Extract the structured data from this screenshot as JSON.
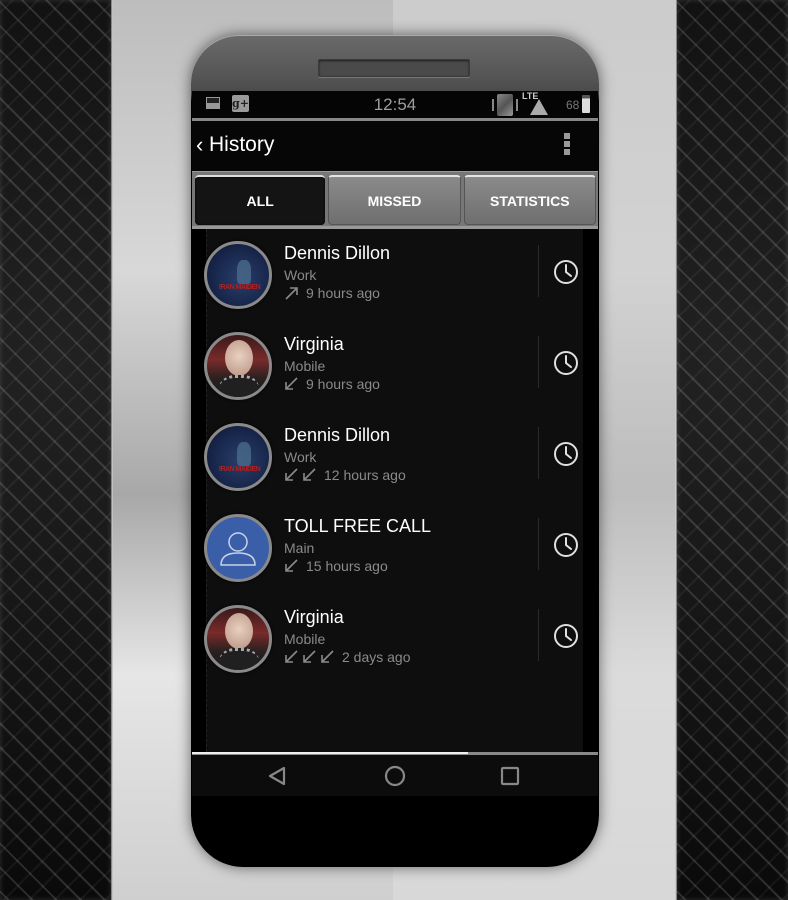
{
  "status_bar": {
    "time": "12:54",
    "network": "LTE",
    "battery": "68",
    "battery_level_percent": 68,
    "icons": [
      "image-icon",
      "google-plus-icon",
      "vibrate-icon",
      "lte-signal-icon",
      "battery-icon"
    ],
    "gplus_glyph": "g+"
  },
  "action_bar": {
    "back_glyph": "‹",
    "title": "History"
  },
  "tabs": [
    {
      "label": "ALL",
      "active": true
    },
    {
      "label": "MISSED",
      "active": false
    },
    {
      "label": "STATISTICS",
      "active": false
    }
  ],
  "calls": [
    {
      "name": "Dennis Dillon",
      "type": "Work",
      "directions": [
        "outgoing"
      ],
      "time": "9 hours ago",
      "avatar": "band-artwork"
    },
    {
      "name": "Virginia",
      "type": "Mobile",
      "directions": [
        "incoming"
      ],
      "time": "9 hours ago",
      "avatar": "photo"
    },
    {
      "name": "Dennis Dillon",
      "type": "Work",
      "directions": [
        "incoming",
        "incoming"
      ],
      "time": "12 hours ago",
      "avatar": "band-artwork"
    },
    {
      "name": "TOLL FREE CALL",
      "type": "Main",
      "directions": [
        "incoming"
      ],
      "time": "15 hours ago",
      "avatar": "generic-contact"
    },
    {
      "name": "Virginia",
      "type": "Mobile",
      "directions": [
        "incoming",
        "incoming",
        "incoming"
      ],
      "time": "2 days ago",
      "avatar": "photo"
    }
  ],
  "scroll_progress": 0.68,
  "nav_bar": [
    "back",
    "home",
    "recents"
  ],
  "colors": {
    "accent_generic_avatar": "#3a5fa8",
    "text_primary": "#ffffff",
    "text_secondary": "#8a8a8a"
  }
}
